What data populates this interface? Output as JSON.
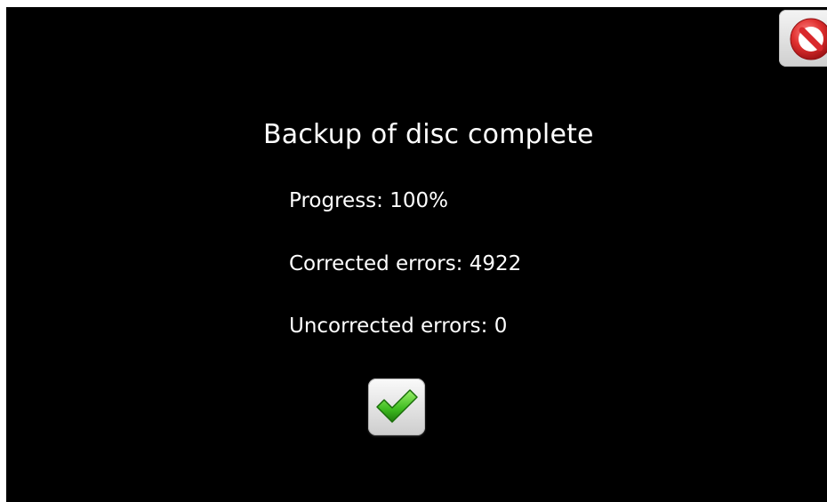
{
  "dialog": {
    "title": "Backup of disc complete",
    "progress_text": "Progress: 100%",
    "progress_value": 100,
    "corrected_errors_text": "Corrected errors: 4922",
    "corrected_errors": 4922,
    "uncorrected_errors_text": "Uncorrected errors: 0",
    "uncorrected_errors": 0
  },
  "buttons": {
    "close": {
      "icon": "no-entry-icon",
      "color": "#d9282c"
    },
    "confirm": {
      "icon": "checkmark-icon",
      "color": "#3dbb1f"
    }
  },
  "colors": {
    "background": "#000000",
    "text": "#ffffff"
  }
}
